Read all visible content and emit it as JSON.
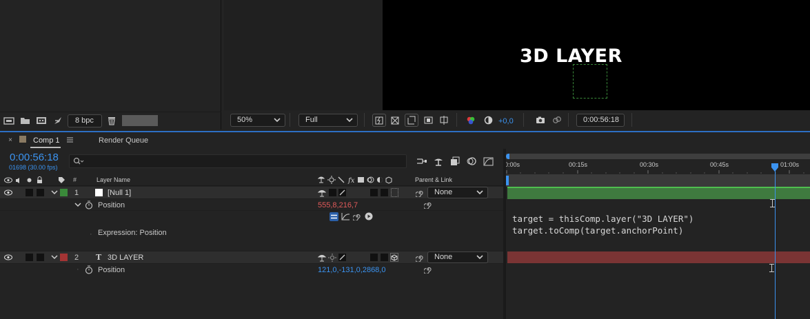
{
  "project_panel": {
    "bpc_label": "8 bpc",
    "icons": [
      "interpret-footage-icon",
      "folder-icon",
      "new-comp-icon",
      "flowchart-icon",
      "trash-icon"
    ]
  },
  "viewer": {
    "preview_text": "3D LAYER",
    "zoom": "50%",
    "resolution": "Full",
    "exposure": "+0,0",
    "current_time": "0:00:56:18"
  },
  "timeline": {
    "tabs": [
      {
        "label": "Comp 1",
        "color": "#8a7a62",
        "active": true
      },
      {
        "label": "Render Queue",
        "active": false
      }
    ],
    "timecode": "0:00:56:18",
    "frame_info": "01698 (30.00 fps)",
    "search_placeholder": "",
    "columns": {
      "num": "#",
      "layer_name": "Layer Name",
      "parent_link": "Parent & Link"
    },
    "ruler_ticks": [
      "0:00s",
      "00:15s",
      "00:30s",
      "00:45s",
      "01:00s"
    ],
    "layers": [
      {
        "index": "1",
        "name": "[Null 1]",
        "label_color": "#3a8a3a",
        "bar_color": "#3f7a3f",
        "parent": "None",
        "property": "Position",
        "value": "555,8,216,7",
        "value_color": "red",
        "expression_label": "Expression: Position",
        "expression_lines": [
          "target = thisComp.layer(\"3D LAYER\")",
          "target.toComp(target.anchorPoint)"
        ]
      },
      {
        "index": "2",
        "type_icon": "T",
        "name": "3D LAYER",
        "label_color": "#a33434",
        "bar_color": "#7a3434",
        "parent": "None",
        "property": "Position",
        "value": "121,0,-131,0,2868,0",
        "value_color": "blue"
      }
    ]
  }
}
